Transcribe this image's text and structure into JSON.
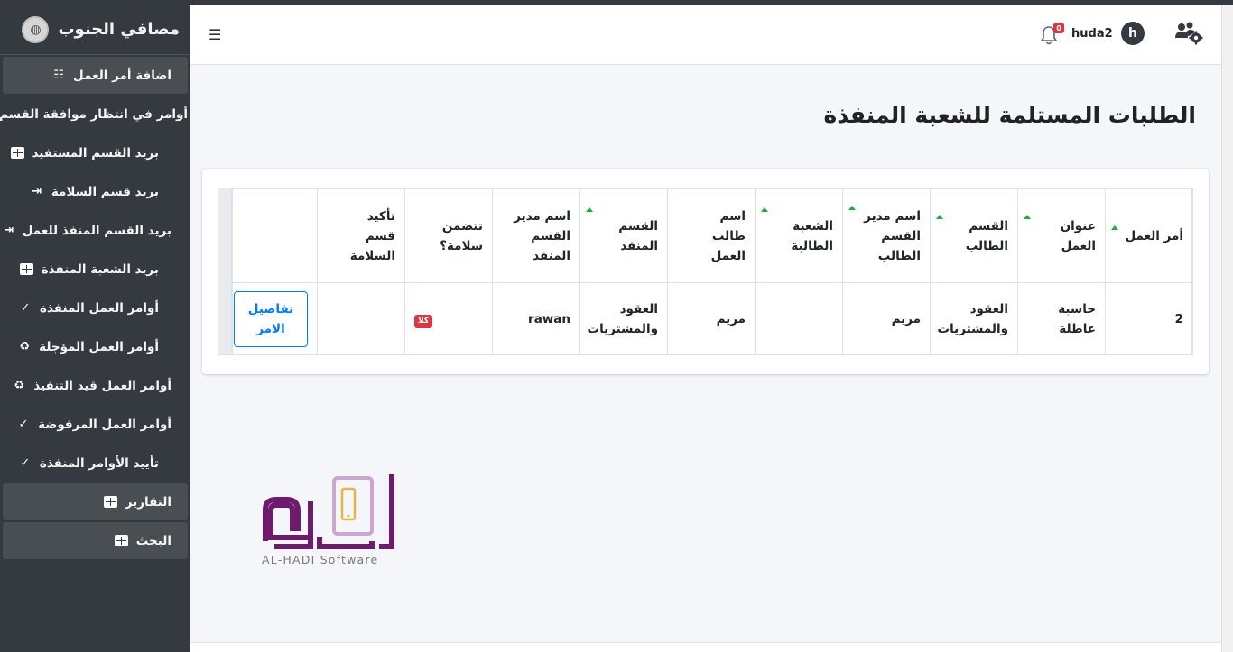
{
  "brand": {
    "name": "مصافي الجنوب"
  },
  "sidebar": {
    "items": [
      {
        "label": "اضافة أمر العمل",
        "icon": "list-check-icon"
      },
      {
        "label": "أوامر في انتظار موافقة القسم",
        "icon": "list-check-icon"
      },
      {
        "label": "بريد القسم المستفيد",
        "icon": "grid-table-icon"
      },
      {
        "label": "بريد قسم السلامة",
        "icon": "file-import-icon"
      },
      {
        "label": "بريد القسم المنفذ للعمل",
        "icon": "file-import-icon"
      },
      {
        "label": "بريد الشعبة المنفذة",
        "icon": "grid-table-icon"
      },
      {
        "label": "أوامر العمل المنفذة",
        "icon": "clipboard-check-icon"
      },
      {
        "label": "أوامر العمل المؤجلة",
        "icon": "recycle-icon"
      },
      {
        "label": "أوامر العمل قيد التنفيذ",
        "icon": "recycle-icon"
      },
      {
        "label": "أوامر العمل المرفوضة",
        "icon": "clipboard-check-icon"
      },
      {
        "label": "تأييد الأوامر المنفذة",
        "icon": "clipboard-check-icon"
      },
      {
        "label": "التقارير",
        "icon": "grid-table-icon"
      },
      {
        "label": "البحث",
        "icon": "grid-table-icon"
      }
    ]
  },
  "navbar": {
    "menu_icon": "hamburger-icon",
    "username": "huda2",
    "avatar_letter": "h",
    "notifications_count": "0"
  },
  "page": {
    "title": "الطلبات المستلمة للشعبة المنفذة"
  },
  "table": {
    "columns": [
      "أمر العمل",
      "عنوان العمل",
      "القسم الطالب",
      "اسم مدير القسم الطالب",
      "الشعبة الطالبة",
      "اسم طالب العمل",
      "القسم المنفذ",
      "اسم مدير القسم المنفذ",
      "تتضمن سلامة؟",
      "تأكيد قسم السلامة",
      ""
    ],
    "rows": [
      {
        "order": "2",
        "title": "حاسبة عاطلة",
        "req_dept": "العقود والمشتريات",
        "req_manager": "مريم",
        "req_branch": "",
        "requester": "مريم",
        "exec_dept": "العقود والمشتريات",
        "exec_manager": "rawan",
        "safety": "كلا",
        "safety_confirm": "",
        "action": "تفاصيل الامر"
      }
    ]
  },
  "watermark": {
    "text": "AL-HADI Software"
  }
}
